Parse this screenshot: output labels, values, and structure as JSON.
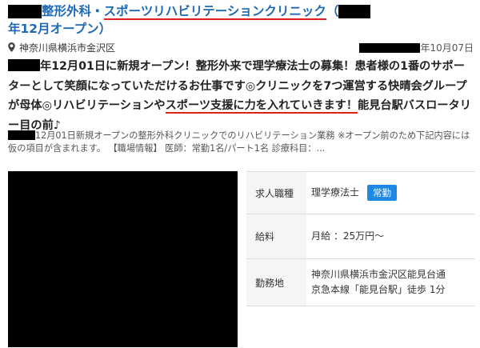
{
  "job": {
    "title_part1": "整形外科・",
    "title_clinic": "スポーツリハビリテーションクリニック",
    "title_paren": "（",
    "title_line2": "年12月オープン）",
    "location": "神奈川県横浜市金沢区",
    "date": "年10月07日",
    "headline_a": "年12月01日に新規オープン！整形外来で理学療法士の募集！患者様の1番のサポーターとして笑顔になっていただけるお仕事です",
    "headline_b": "クリニックを7つ運営する快晴会グループが母体",
    "headline_c": "リハビリテーションや",
    "headline_red": "スポーツ支援に力を入れていきます！",
    "headline_d": "能見台駅バスロータリー目の前♪",
    "headline_mark": "◎",
    "description": "12月01日新規オープンの整形外科クリニックでのリハビリテーション業務 ※オープン前のため下記内容には仮の項目が含まれます。 【職場情報】 医師：常勤1名/パート1名 診療科目：..."
  },
  "info_table": {
    "job_type_label": "求人職種",
    "job_type_value": "理学療法士",
    "employment_badge": "常勤",
    "salary_label": "給料",
    "salary_value": "月給 ：25万円〜",
    "location_label": "勤務地",
    "location_line1": "神奈川県横浜市金沢区能見台通",
    "location_line2": "京急本線「能見台駅」徒歩 1分"
  },
  "colors": {
    "title_blue": "#1e68b4",
    "underline_red": "#e0201a",
    "badge_blue": "#1e88e5"
  }
}
